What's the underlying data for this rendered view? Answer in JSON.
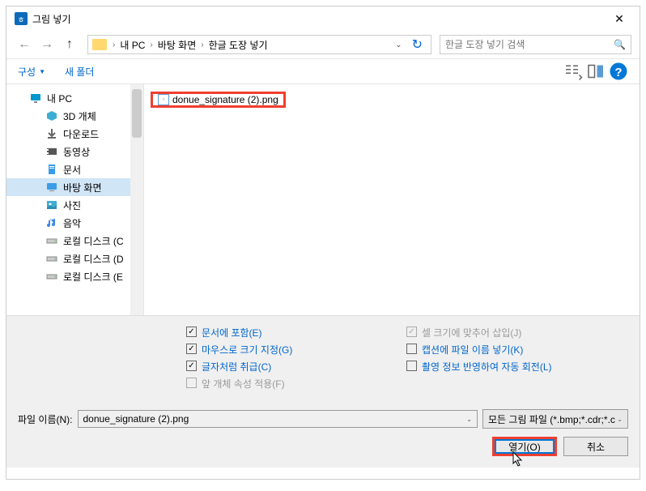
{
  "window": {
    "title": "그림 넣기",
    "close": "✕"
  },
  "nav": {
    "back": "←",
    "forward": "→",
    "up": "↑"
  },
  "breadcrumb": {
    "items": [
      "내 PC",
      "바탕 화면",
      "한글 도장 넣기"
    ]
  },
  "search": {
    "placeholder": "한글 도장 넣기 검색"
  },
  "toolbar": {
    "organize": "구성",
    "newfolder": "새 폴더"
  },
  "tree": {
    "items": [
      {
        "label": "내 PC",
        "icon": "pc",
        "sub": false
      },
      {
        "label": "3D 개체",
        "icon": "3d",
        "sub": true
      },
      {
        "label": "다운로드",
        "icon": "download",
        "sub": true
      },
      {
        "label": "동영상",
        "icon": "video",
        "sub": true
      },
      {
        "label": "문서",
        "icon": "doc",
        "sub": true
      },
      {
        "label": "바탕 화면",
        "icon": "desktop",
        "sub": true,
        "selected": true
      },
      {
        "label": "사진",
        "icon": "pic",
        "sub": true
      },
      {
        "label": "음악",
        "icon": "music",
        "sub": true
      },
      {
        "label": "로컬 디스크 (C",
        "icon": "disk",
        "sub": true
      },
      {
        "label": "로컬 디스크 (D",
        "icon": "disk",
        "sub": true
      },
      {
        "label": "로컬 디스크 (E",
        "icon": "disk",
        "sub": true
      }
    ]
  },
  "file": {
    "name": "donue_signature (2).png"
  },
  "options": {
    "left": [
      {
        "label": "문서에 포함(E)",
        "checked": true,
        "disabled": false
      },
      {
        "label": "마우스로 크기 지정(G)",
        "checked": true,
        "disabled": false
      },
      {
        "label": "글자처럼 취급(C)",
        "checked": true,
        "disabled": false
      },
      {
        "label": "앞 개체 속성 적용(F)",
        "checked": false,
        "disabled": true
      }
    ],
    "right": [
      {
        "label": "셀 크기에 맞추어 삽입(J)",
        "checked": true,
        "disabled": true
      },
      {
        "label": "캡션에 파일 이름 넣기(K)",
        "checked": false,
        "disabled": false
      },
      {
        "label": "촬영 정보 반영하여 자동 회전(L)",
        "checked": false,
        "disabled": false
      }
    ]
  },
  "filenameRow": {
    "label": "파일 이름(N):",
    "value": "donue_signature (2).png",
    "filter": "모든 그림 파일 (*.bmp;*.cdr;*.c"
  },
  "buttons": {
    "open": "열기(O)",
    "cancel": "취소"
  }
}
